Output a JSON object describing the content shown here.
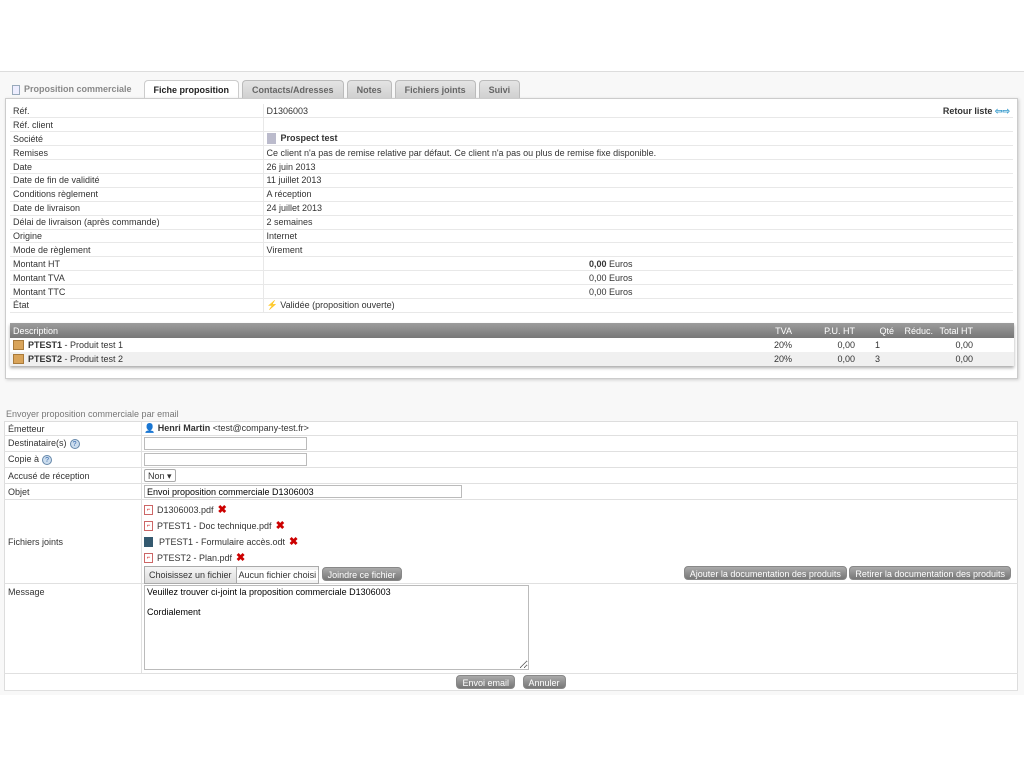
{
  "tabs": [
    "Proposition commerciale",
    "Fiche proposition",
    "Contacts/Adresses",
    "Notes",
    "Fichiers joints",
    "Suivi"
  ],
  "back_link": "Retour liste",
  "fields": [
    {
      "label": "Réf.",
      "value": "D1306003"
    },
    {
      "label": "Réf. client",
      "value": ""
    },
    {
      "label": "Société",
      "value": "Prospect test"
    },
    {
      "label": "Remises",
      "value": "Ce client n'a pas de remise relative par défaut. Ce client n'a pas ou plus de remise fixe disponible."
    },
    {
      "label": "Date",
      "value": "26 juin 2013"
    },
    {
      "label": "Date de fin de validité",
      "value": "11 juillet 2013"
    },
    {
      "label": "Conditions règlement",
      "value": "A réception"
    },
    {
      "label": "Date de livraison",
      "value": "24 juillet 2013"
    },
    {
      "label": "Délai de livraison (après commande)",
      "value": "2 semaines"
    },
    {
      "label": "Origine",
      "value": "Internet"
    },
    {
      "label": "Mode de règlement",
      "value": "Virement"
    },
    {
      "label": "Montant HT",
      "value": "0,00",
      "unit": "Euros"
    },
    {
      "label": "Montant TVA",
      "value": "0,00",
      "unit": "Euros"
    },
    {
      "label": "Montant TTC",
      "value": "0,00",
      "unit": "Euros"
    },
    {
      "label": "État",
      "value": "Validée (proposition ouverte)"
    }
  ],
  "lines": {
    "headers": [
      "Description",
      "TVA",
      "P.U. HT",
      "Qté",
      "Réduc.",
      "Total HT"
    ],
    "rows": [
      {
        "ref": "PTEST1",
        "label": " - Produit test 1",
        "tva": "20%",
        "pu": "0,00",
        "qty": "1",
        "reduc": "",
        "total": "0,00"
      },
      {
        "ref": "PTEST2",
        "label": " - Produit test 2",
        "tva": "20%",
        "pu": "0,00",
        "qty": "3",
        "reduc": "",
        "total": "0,00"
      }
    ]
  },
  "mail": {
    "title": "Envoyer proposition commerciale par email",
    "sender_label": "Émetteur",
    "sender_name": "Henri Martin",
    "sender_email": "<test@company-test.fr>",
    "to_label": "Destinataire(s)",
    "to_value": "",
    "cc_label": "Copie à",
    "cc_value": "",
    "ack_label": "Accusé de réception",
    "ack_value": "Non",
    "subject_label": "Objet",
    "subject_value": "Envoi proposition commerciale D1306003",
    "files_label": "Fichiers joints",
    "files": [
      "D1306003.pdf",
      "PTEST1 - Doc technique.pdf",
      "PTEST1 - Formulaire accès.odt",
      "PTEST2 - Plan.pdf"
    ],
    "choose_file": "Choisissez un fichier",
    "no_file": "Aucun fichier choisi",
    "attach": "Joindre ce fichier",
    "add_docs": "Ajouter la documentation des produits",
    "remove_docs": "Retirer la documentation des produits",
    "message_label": "Message",
    "message_value": "Veuillez trouver ci-joint la proposition commerciale D1306003\n\nCordialement",
    "send": "Envoi email",
    "cancel": "Annuler"
  }
}
